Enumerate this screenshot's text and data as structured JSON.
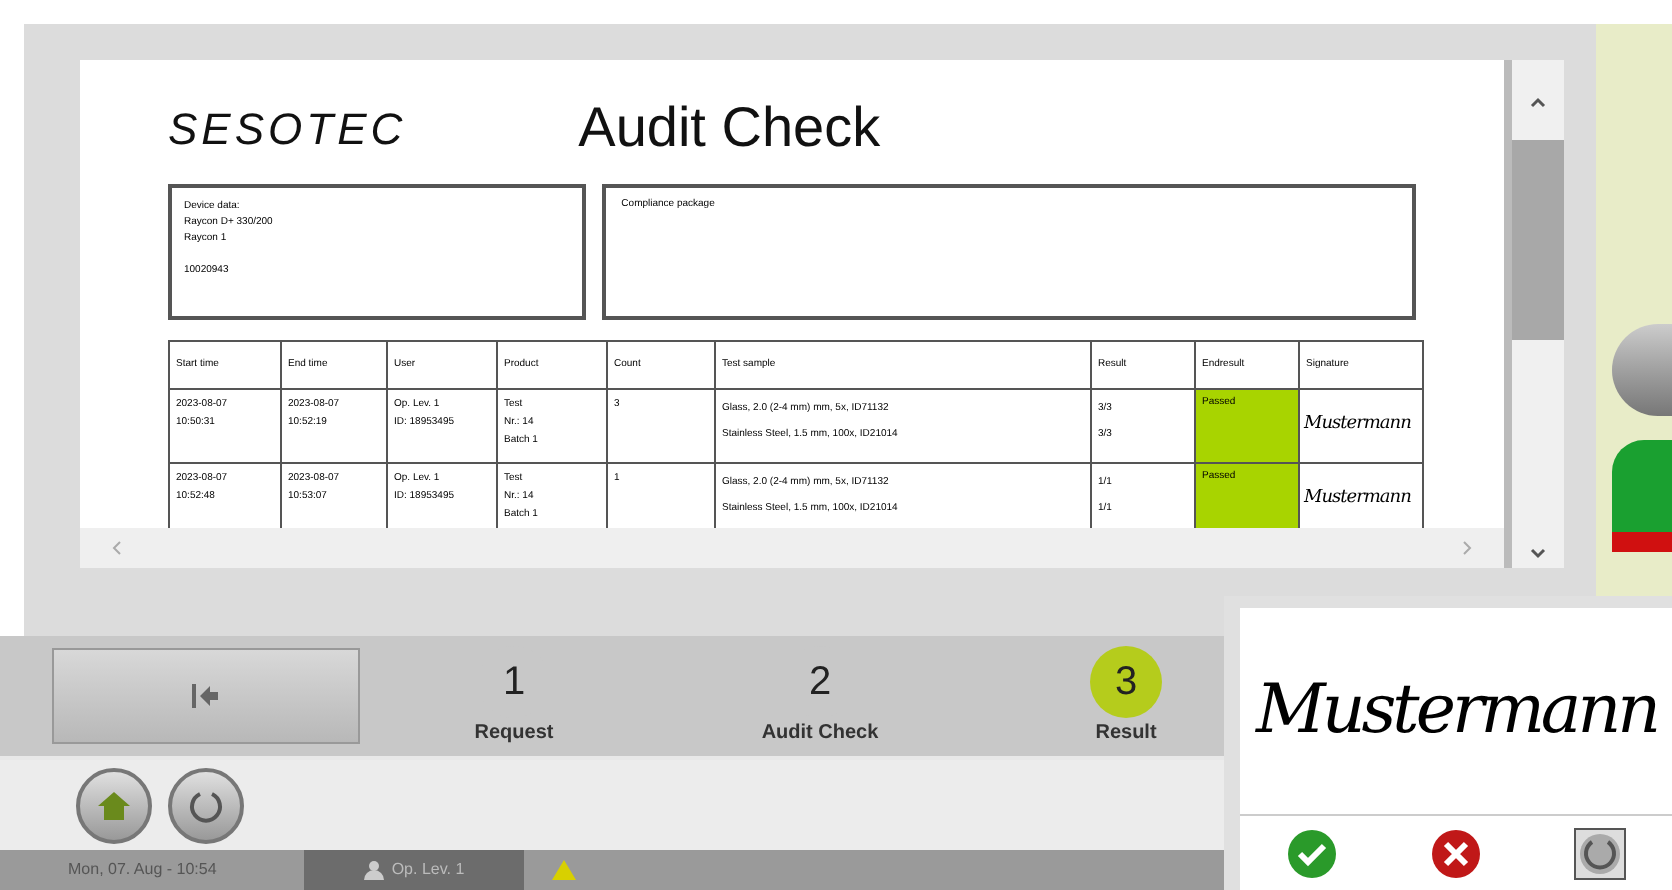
{
  "document": {
    "logo": "SESOTEC",
    "title": "Audit Check",
    "device_box": {
      "lines": [
        "Device data:",
        "Raycon D+ 330/200",
        "Raycon 1"
      ],
      "serial": "10020943"
    },
    "compliance_box": {
      "label": "Compliance package"
    },
    "table": {
      "columns": [
        "Start time",
        "End time",
        "User",
        "Product",
        "Count",
        "Test sample",
        "Result",
        "Endresult",
        "Signature"
      ],
      "rows": [
        {
          "start": [
            "2023-08-07",
            "10:50:31"
          ],
          "end": [
            "2023-08-07",
            "10:52:19"
          ],
          "user": [
            "Op. Lev. 1",
            "ID: 18953495"
          ],
          "product": [
            "Test",
            "Nr.: 14",
            "Batch 1"
          ],
          "count": "3",
          "samples": [
            "Glass, 2.0 (2-4 mm) mm, 5x, ID71132",
            "Stainless Steel, 1.5 mm, 100x, ID21014"
          ],
          "results": [
            "3/3",
            "3/3"
          ],
          "endresult": "Passed",
          "passed": true,
          "signature": "Mustermann"
        },
        {
          "start": [
            "2023-08-07",
            "10:52:48"
          ],
          "end": [
            "2023-08-07",
            "10:53:07"
          ],
          "user": [
            "Op. Lev. 1",
            "ID: 18953495"
          ],
          "product": [
            "Test",
            "Nr.: 14",
            "Batch 1"
          ],
          "count": "1",
          "samples": [
            "Glass, 2.0 (2-4 mm) mm, 5x, ID71132",
            "Stainless Steel, 1.5 mm, 100x, ID21014"
          ],
          "results": [
            "1/1",
            "1/1"
          ],
          "endresult": "Passed",
          "passed": true,
          "signature": "Mustermann"
        }
      ]
    }
  },
  "steps": [
    {
      "number": "1",
      "label": "Request",
      "selected": false
    },
    {
      "number": "2",
      "label": "Audit Check",
      "selected": false
    },
    {
      "number": "3",
      "label": "Result",
      "selected": true
    }
  ],
  "status_bar": {
    "datetime": "Mon, 07. Aug - 10:54",
    "user": "Op. Lev. 1"
  },
  "signature_dialog": {
    "signature": "Mustermann"
  }
}
